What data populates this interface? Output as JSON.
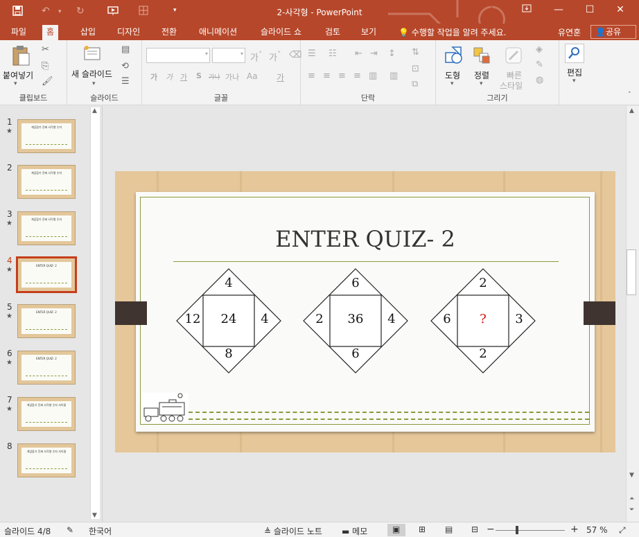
{
  "titlebar": {
    "doc_title": "2-사각형 - PowerPoint",
    "quick_access": {
      "save_icon": "save-icon",
      "undo_icon": "undo-icon",
      "redo_icon": "redo-icon",
      "present_icon": "slideshow-from-start-icon",
      "layout_icon": "layout-icon",
      "customize_icon": "chevron-down-icon"
    },
    "window_controls": {
      "restore_ribbon_icon": "ribbon-display-options-icon",
      "minimize_icon": "minimize-icon",
      "maximize_icon": "maximize-icon",
      "close_icon": "close-icon"
    }
  },
  "tabs": [
    {
      "label": "파일",
      "active": false
    },
    {
      "label": "홈",
      "active": true
    },
    {
      "label": "삽입",
      "active": false
    },
    {
      "label": "디자인",
      "active": false
    },
    {
      "label": "전환",
      "active": false
    },
    {
      "label": "애니메이션",
      "active": false
    },
    {
      "label": "슬라이드 쇼",
      "active": false
    },
    {
      "label": "검토",
      "active": false
    },
    {
      "label": "보기",
      "active": false
    }
  ],
  "tell_me": "수행할 작업을 알려 주세요.",
  "user_name": "유연훈",
  "share_label": "공유",
  "ribbon": {
    "clipboard": {
      "paste_label": "붙여넣기",
      "group_label": "클립보드"
    },
    "slides": {
      "new_slide_label": "새 슬라이드",
      "group_label": "슬라이드"
    },
    "font": {
      "group_label": "글꼴",
      "font_name": "",
      "font_size": "",
      "bold": "가",
      "italic": "가",
      "underline": "가",
      "shadow": "S",
      "strike": "가나",
      "spacing": "가나",
      "case": "Aa",
      "color": "가"
    },
    "paragraph": {
      "group_label": "단락"
    },
    "drawing": {
      "shapes_label": "도형",
      "arrange_label": "정렬",
      "quick_styles_label_1": "빠른",
      "quick_styles_label_2": "스타일",
      "group_label": "그리기"
    },
    "editing": {
      "label": "편집",
      "icon": "search-icon"
    }
  },
  "thumbnails": [
    {
      "number": "1",
      "star": true,
      "current": false,
      "caption": "개념잡기 진짜 사각형 숫자"
    },
    {
      "number": "2",
      "star": false,
      "current": false,
      "caption": "개념잡기 진짜 사각형 숫자"
    },
    {
      "number": "3",
      "star": true,
      "current": false,
      "caption": "개념잡기 진짜 사각형 숫자"
    },
    {
      "number": "4",
      "star": true,
      "current": true,
      "caption": "ENTER QUIZ- 2"
    },
    {
      "number": "5",
      "star": true,
      "current": false,
      "caption": "ENTER QUIZ- 2"
    },
    {
      "number": "6",
      "star": true,
      "current": false,
      "caption": "ENTER QUIZ- 2"
    },
    {
      "number": "7",
      "star": true,
      "current": false,
      "caption": "개념잡기 진짜 사각형 숫자 사이클"
    },
    {
      "number": "8",
      "star": false,
      "current": false,
      "caption": "개념잡기 진짜 사각형 숫자 사이클"
    }
  ],
  "slide": {
    "title": "ENTER QUIZ- 2",
    "puzzles": [
      {
        "top": "4",
        "left": "12",
        "center": "24",
        "right": "4",
        "bottom": "8"
      },
      {
        "top": "6",
        "left": "2",
        "center": "36",
        "right": "4",
        "bottom": "6"
      },
      {
        "top": "2",
        "left": "6",
        "center": "?",
        "right": "3",
        "bottom": "2"
      }
    ],
    "train_icon": "train-icon"
  },
  "status": {
    "slide_indicator": "슬라이드 4/8",
    "language": "한국어",
    "notes_label": "슬라이드 노트",
    "comments_label": "메모",
    "zoom_level": "57 %"
  },
  "colors": {
    "accent": "#b7472a",
    "frame": "#8a9a3c",
    "wood": "#e5c79a",
    "question_mark": "#d01010"
  }
}
